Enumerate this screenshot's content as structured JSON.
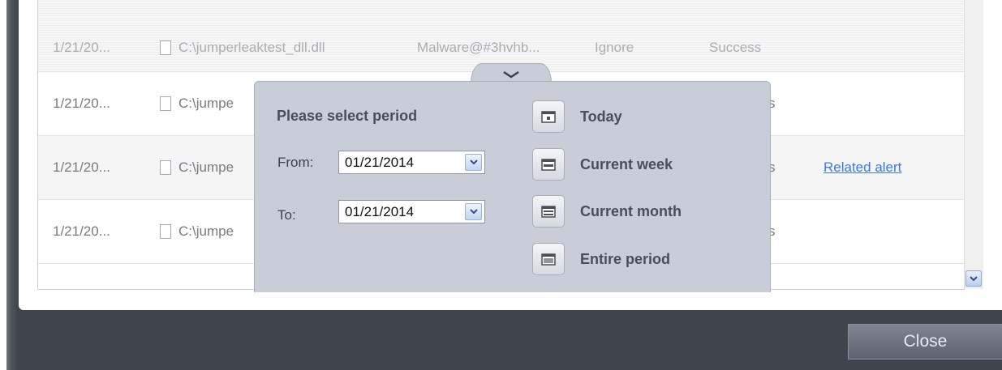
{
  "table": {
    "rows": [
      {
        "date": "1/21/20...",
        "file": "C:\\jumperleaktest_dll.dll",
        "threat": "Malware@#3hvhb...",
        "action": "Ignore",
        "status": "Success",
        "alert": ""
      },
      {
        "date": "1/21/20...",
        "file": "C:\\jumpe",
        "threat": "",
        "action": "",
        "status": "s",
        "alert": ""
      },
      {
        "date": "1/21/20...",
        "file": "C:\\jumpe",
        "threat": "",
        "action": "",
        "status": "s",
        "alert": "Related alert"
      },
      {
        "date": "1/21/20...",
        "file": "C:\\jumpe",
        "threat": "",
        "action": "",
        "status": "s",
        "alert": ""
      }
    ]
  },
  "period_popup": {
    "title": "Please select period",
    "from_label": "From:",
    "from_value": "01/21/2014",
    "to_label": "To:",
    "to_value": "01/21/2014",
    "options": [
      "Today",
      "Current week",
      "Current month",
      "Entire period"
    ]
  },
  "footer": {
    "close_label": "Close"
  }
}
